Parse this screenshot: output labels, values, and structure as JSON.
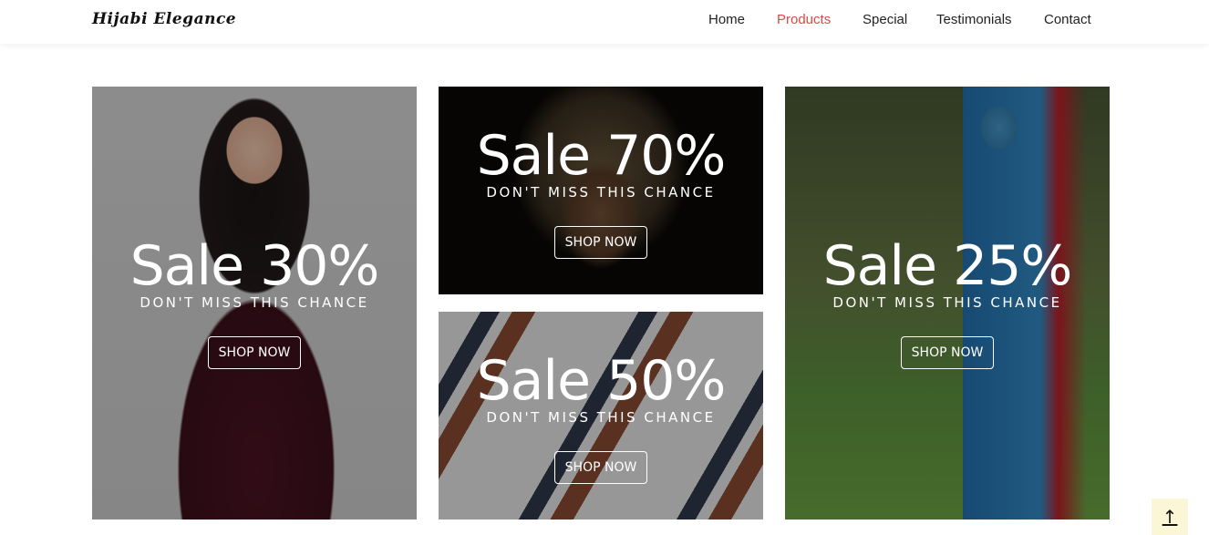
{
  "brand": {
    "name": "Hijabi Elegance"
  },
  "nav": {
    "items": [
      {
        "label": "Home",
        "active": false
      },
      {
        "label": "Products",
        "active": true
      },
      {
        "label": "Special",
        "active": false
      },
      {
        "label": "Testimonials",
        "active": false
      },
      {
        "label": "Contact",
        "active": false
      }
    ]
  },
  "promos": [
    {
      "title": "Sale 30%",
      "subtitle": "DON'T MISS THIS CHANCE",
      "button": "SHOP NOW"
    },
    {
      "title": "Sale 70%",
      "subtitle": "DON'T MISS THIS CHANCE",
      "button": "SHOP NOW"
    },
    {
      "title": "Sale 50%",
      "subtitle": "DON'T MISS THIS CHANCE",
      "button": "SHOP NOW"
    },
    {
      "title": "Sale 25%",
      "subtitle": "DON'T MISS THIS CHANCE",
      "button": "SHOP NOW"
    }
  ],
  "scroll_top": {
    "icon": "arrow-up-icon",
    "glyph": "↑"
  },
  "colors": {
    "accent": "#e04848",
    "scroll_top_bg": "#fbf7d6"
  }
}
